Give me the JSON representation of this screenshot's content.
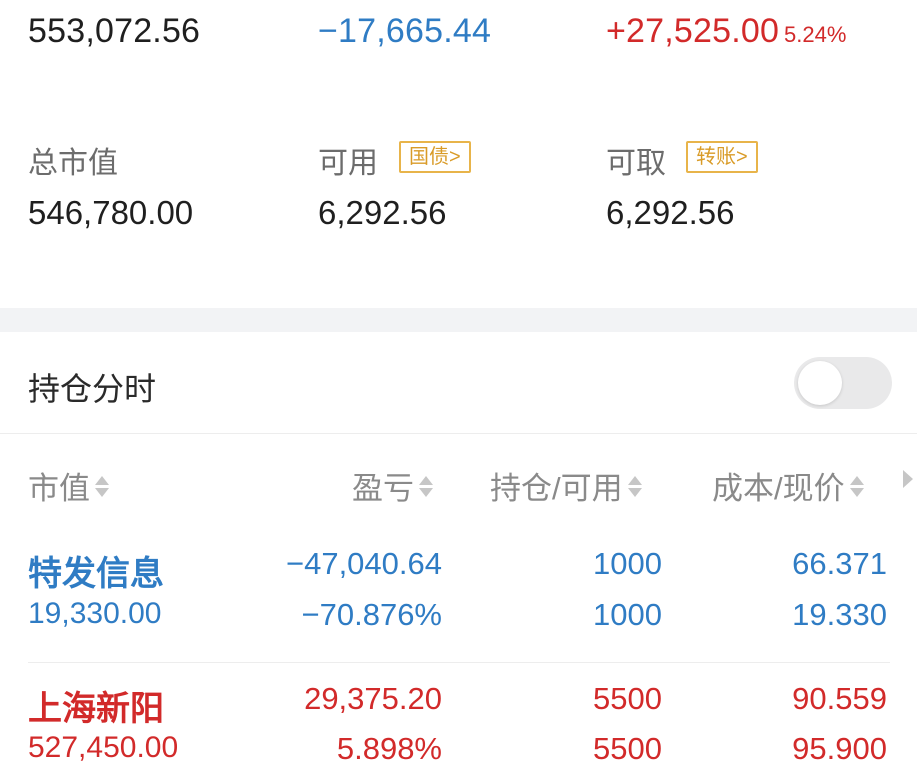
{
  "summary": {
    "total_assets": "553,072.56",
    "daily_pnl": "−17,665.44",
    "total_pnl": "+27,525.00",
    "total_pnl_pct": "5.24%"
  },
  "metrics": {
    "market_value_label": "总市值",
    "market_value": "546,780.00",
    "available_label": "可用",
    "available_tag": "国债",
    "available": "6,292.56",
    "withdrawable_label": "可取",
    "withdrawable_tag": "转账",
    "withdrawable": "6,292.56"
  },
  "intraday": {
    "label": "持仓分时",
    "toggle_on": false
  },
  "table": {
    "headers": [
      "市值",
      "盈亏",
      "持仓/可用",
      "成本/现价"
    ],
    "rows": [
      {
        "name": "特发信息",
        "market_value": "19,330.00",
        "pnl": "−47,040.64",
        "pnl_pct": "−70.876%",
        "position": "1000",
        "available": "1000",
        "cost": "66.371",
        "price": "19.330",
        "color": "#2f7cc4"
      },
      {
        "name": "上海新阳",
        "market_value": "527,450.00",
        "pnl": "29,375.20",
        "pnl_pct": "5.898%",
        "position": "5500",
        "available": "5500",
        "cost": "90.559",
        "price": "95.900",
        "color": "#d22a2a"
      }
    ]
  },
  "colors": {
    "loss": "#2f7cc4",
    "gain": "#d22a2a",
    "tag": "#e8b44a"
  }
}
